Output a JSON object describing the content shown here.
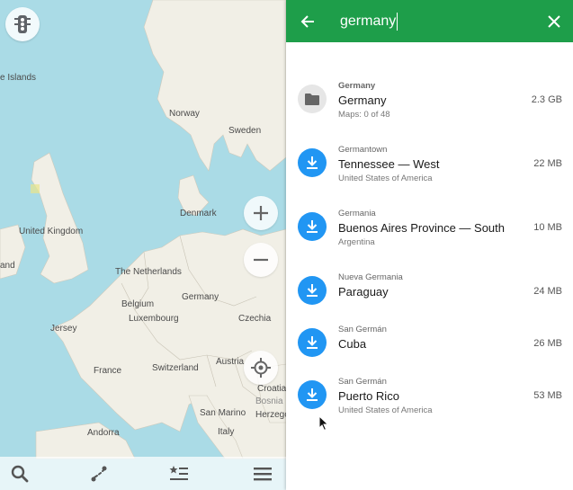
{
  "map": {
    "labels": [
      {
        "key": "faroe",
        "text": "e Islands"
      },
      {
        "key": "norway",
        "text": "Norway"
      },
      {
        "key": "sweden",
        "text": "Sweden"
      },
      {
        "key": "denmark",
        "text": "Denmark"
      },
      {
        "key": "uk",
        "text": "United Kingdom"
      },
      {
        "key": "ireland",
        "text": "and"
      },
      {
        "key": "netherlands",
        "text": "The Netherlands"
      },
      {
        "key": "germany",
        "text": "Germany"
      },
      {
        "key": "belgium",
        "text": "Belgium"
      },
      {
        "key": "luxembourg",
        "text": "Luxembourg"
      },
      {
        "key": "czechia",
        "text": "Czechia"
      },
      {
        "key": "jersey",
        "text": "Jersey"
      },
      {
        "key": "austria",
        "text": "Austria"
      },
      {
        "key": "france",
        "text": "France"
      },
      {
        "key": "switzerland",
        "text": "Switzerland"
      },
      {
        "key": "croatia",
        "text": "Croatia"
      },
      {
        "key": "sanmarino",
        "text": "San Marino"
      },
      {
        "key": "bosnia",
        "text": "Herzego"
      },
      {
        "key": "italy",
        "text": "Italy"
      },
      {
        "key": "andorra",
        "text": "Andorra"
      },
      {
        "key": "faint",
        "text": "Bosnia"
      }
    ],
    "buttons": {
      "traffic_icon": "traffic-light-icon",
      "zoom_in_icon": "plus-icon",
      "zoom_out_icon": "minus-icon",
      "locate_icon": "crosshair-icon"
    },
    "bottom_bar": {
      "search_icon": "search-icon",
      "route_icon": "route-icon",
      "bookmarks_icon": "star-list-icon",
      "menu_icon": "hamburger-menu-icon"
    }
  },
  "search": {
    "query": "germany",
    "back_icon": "arrow-left-icon",
    "clear_icon": "close-icon",
    "accent_color": "#1e9e4a"
  },
  "results": [
    {
      "icon": "folder-icon",
      "subtitle": "Germany",
      "name": "Germany",
      "meta": "Maps: 0 of 48",
      "size": "2.3 GB"
    },
    {
      "icon": "download-icon",
      "subtitle": "Germantown",
      "name": "Tennessee — West",
      "meta": "United States of America",
      "size": "22 MB"
    },
    {
      "icon": "download-icon",
      "subtitle": "Germania",
      "name": "Buenos Aires Province — South",
      "meta": "Argentina",
      "size": "10 MB"
    },
    {
      "icon": "download-icon",
      "subtitle": "Nueva Germania",
      "name": "Paraguay",
      "meta": "",
      "size": "24 MB"
    },
    {
      "icon": "download-icon",
      "subtitle": "San Germán",
      "name": "Cuba",
      "meta": "",
      "size": "26 MB"
    },
    {
      "icon": "download-icon",
      "subtitle": "San Germán",
      "name": "Puerto Rico",
      "meta": "United States of America",
      "size": "53 MB"
    }
  ],
  "colors": {
    "download": "#2196f3",
    "folder_bg": "#e6e6e6",
    "water": "#aadbe6",
    "land": "#f1efe6"
  }
}
